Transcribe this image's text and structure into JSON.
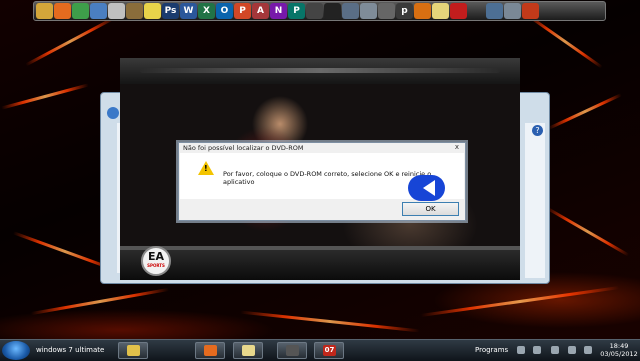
{
  "dock": {
    "icons": [
      {
        "name": "folder-icon",
        "glyph": "",
        "color": "#d4a63a"
      },
      {
        "name": "firefox-icon",
        "glyph": "",
        "color": "#e56b1f"
      },
      {
        "name": "chrome-icon",
        "glyph": "",
        "color": "#3e9e4a"
      },
      {
        "name": "network-icon",
        "glyph": "",
        "color": "#4a7fc1"
      },
      {
        "name": "tools-icon",
        "glyph": "",
        "color": "#c0c0c0"
      },
      {
        "name": "gimp-icon",
        "glyph": "",
        "color": "#8a6d3b"
      },
      {
        "name": "paint-icon",
        "glyph": "",
        "color": "#e8d44a"
      },
      {
        "name": "photoshop-icon",
        "glyph": "Ps",
        "color": "#1b3c6e"
      },
      {
        "name": "word-icon",
        "glyph": "W",
        "color": "#2b579a"
      },
      {
        "name": "excel-icon",
        "glyph": "X",
        "color": "#217346"
      },
      {
        "name": "outlook-icon",
        "glyph": "O",
        "color": "#0a64ad"
      },
      {
        "name": "powerpoint-icon",
        "glyph": "P",
        "color": "#d24726"
      },
      {
        "name": "access-icon",
        "glyph": "A",
        "color": "#a4373a"
      },
      {
        "name": "onenote-icon",
        "glyph": "N",
        "color": "#7719aa"
      },
      {
        "name": "publisher-icon",
        "glyph": "P",
        "color": "#077568"
      },
      {
        "name": "media-icon",
        "glyph": "",
        "color": "#444"
      },
      {
        "name": "display-icon",
        "glyph": "",
        "color": "#222"
      },
      {
        "name": "window-icon",
        "glyph": "",
        "color": "#5a6e86"
      },
      {
        "name": "settings-icon",
        "glyph": "",
        "color": "#7f8c99"
      },
      {
        "name": "audio-icon",
        "glyph": "",
        "color": "#666"
      },
      {
        "name": "text-icon",
        "glyph": "p",
        "color": "#3a3a3a"
      },
      {
        "name": "pumpkin-icon",
        "glyph": "",
        "color": "#d86f12"
      },
      {
        "name": "notes-icon",
        "glyph": "",
        "color": "#e5d57a"
      },
      {
        "name": "pdf-icon",
        "glyph": "",
        "color": "#c21d1d"
      },
      {
        "name": "spacer",
        "glyph": "",
        "color": "transparent"
      },
      {
        "name": "windows-icon",
        "glyph": "",
        "color": "#4d6f94"
      },
      {
        "name": "computer-icon",
        "glyph": "",
        "color": "#7a8896"
      },
      {
        "name": "badge-icon",
        "glyph": "",
        "color": "#c23a1a"
      }
    ]
  },
  "dialog": {
    "title": "Não foi possível localizar o DVD-ROM",
    "message": "Por favor, coloque o DVD-ROM correto, selecione OK e reinicie o aplicativo",
    "ok_label": "OK",
    "close_glyph": "x"
  },
  "game": {
    "logo_text": "EA",
    "logo_sub": "SPORTS"
  },
  "explorer": {
    "help_glyph": "?"
  },
  "taskbar": {
    "start_label": "windows 7 ultimate",
    "programs_label": "Programs",
    "time": "18:49",
    "date": "03/05/2012",
    "buttons": [
      {
        "name": "taskbar-explorer-button",
        "color": "#e2c14a"
      },
      {
        "name": "taskbar-firefox-button",
        "color": "#e56b1f"
      },
      {
        "name": "taskbar-notes-button",
        "color": "#e8d88c"
      },
      {
        "name": "taskbar-game-button",
        "color": "#555"
      },
      {
        "name": "taskbar-07-button",
        "color": "#c0271b",
        "glyph": "07"
      }
    ]
  }
}
